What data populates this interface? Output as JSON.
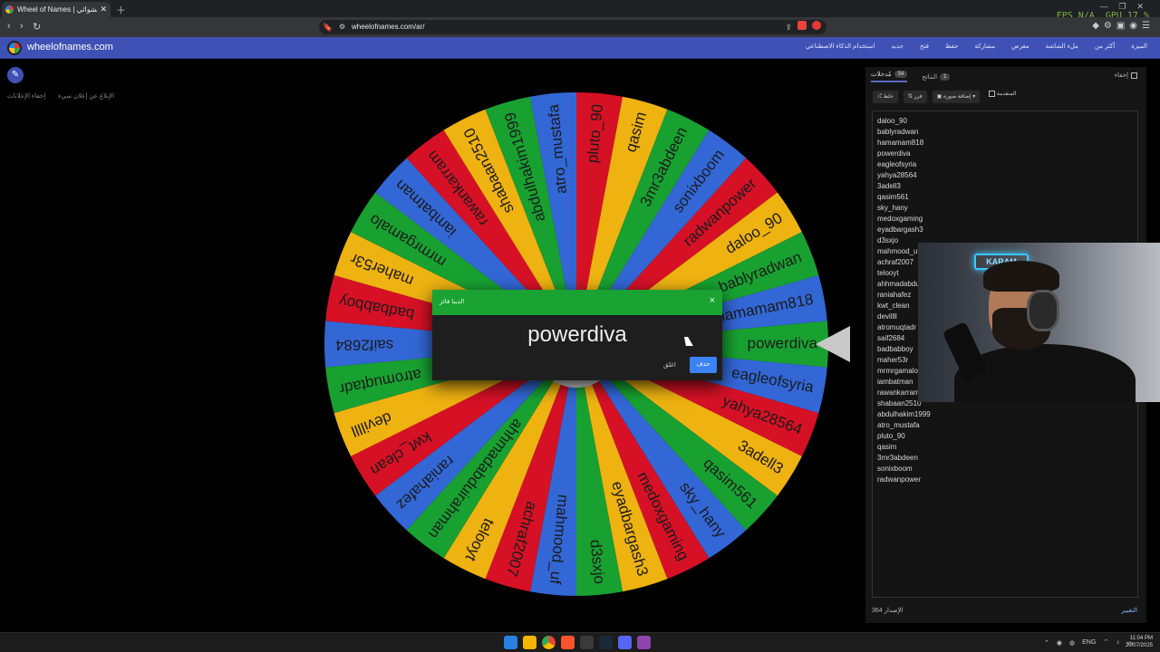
{
  "browser": {
    "tab_title": "Wheel of Names | عجلة الأسماء العشوائي",
    "url": "wheelofnames.com/ar/",
    "fps_label": "FPS",
    "fps_value": "N/A",
    "gpu_label": "GPU",
    "gpu_value": "17 %"
  },
  "site": {
    "name": "wheelofnames.com",
    "menu": [
      "الميزة",
      "أكثر من",
      "ملء الشاشة",
      "معرض",
      "مشاركة",
      "حفظ",
      "فتح",
      "جديد",
      "استخدام الذكاء الاصطناعي"
    ]
  },
  "left": {
    "report_ad": "الإبلاغ عن إعلان سيء",
    "hide_ads": "إخفاء الإعلانات"
  },
  "wheel": {
    "segments": [
      "powerdiva",
      "eagleofsyria",
      "yahya28564",
      "3adell3",
      "qasim561",
      "sky_hany",
      "medoxgaming",
      "eyadbargash3",
      "d3sxjo",
      "mahmood_uf",
      "achraf2007",
      "telooyt",
      "ahhmadabduirahman",
      "raniahafez",
      "kwt_clean",
      "devillll",
      "atromuqtadr",
      "saif2684",
      "badbabboy",
      "maher53r",
      "mrmrgamalo",
      "iambatman",
      "rawankarram",
      "shabaan2510",
      "abdulhakim1999",
      "atro_mustafa",
      "pluto_90",
      "qasim",
      "3mr3abdeen",
      "sonixboom",
      "radwanpower",
      "daloo_90",
      "bablyradwan",
      "hamamam818"
    ],
    "colors": [
      "#18a131",
      "#3367d6",
      "#d61126",
      "#eeb211"
    ]
  },
  "dialog": {
    "title": "لدينا فائز!",
    "winner": "powerdiva",
    "close_label": "اغلق",
    "remove_label": "حذف"
  },
  "panel": {
    "tab_entries_label": "مُدخلات",
    "tab_entries_count": "34",
    "tab_results_label": "النتائج",
    "tab_results_count": "1",
    "hide_label": "إخفاء",
    "controls": {
      "shuffle": "خلط",
      "sort": "فرز",
      "add_image": "إضافة صورة",
      "advanced": "المتقدمة"
    },
    "entries": [
      "daloo_90",
      "bablyradwan",
      "hamamam818",
      "powerdiva",
      "eagleofsyria",
      "yahya28564",
      "3adell3",
      "qasim561",
      "sky_hany",
      "medoxgaming",
      "eyadbargash3",
      "d3sxjo",
      "mahmood_uf",
      "achraf2007",
      "telooyt",
      "ahhmadabduirahman",
      "raniahafez",
      "kwt_clean",
      "devillll",
      "atromuqtadr",
      "saif2684",
      "badbabboy",
      "maher53r",
      "mrmrgamalo",
      "iambatman",
      "rawankarram",
      "shabaan2510",
      "abdulhakim1999",
      "atro_mustafa",
      "pluto_90",
      "qasim",
      "3mr3abdeen",
      "sonixboom",
      "radwanpower"
    ],
    "version": "الإصدار 364",
    "changelog": "التغيير"
  },
  "webcam": {
    "sign": "KARAM"
  },
  "taskbar": {
    "lang": "ENG",
    "time": "11:04 PM",
    "date": "20/07/2025"
  }
}
